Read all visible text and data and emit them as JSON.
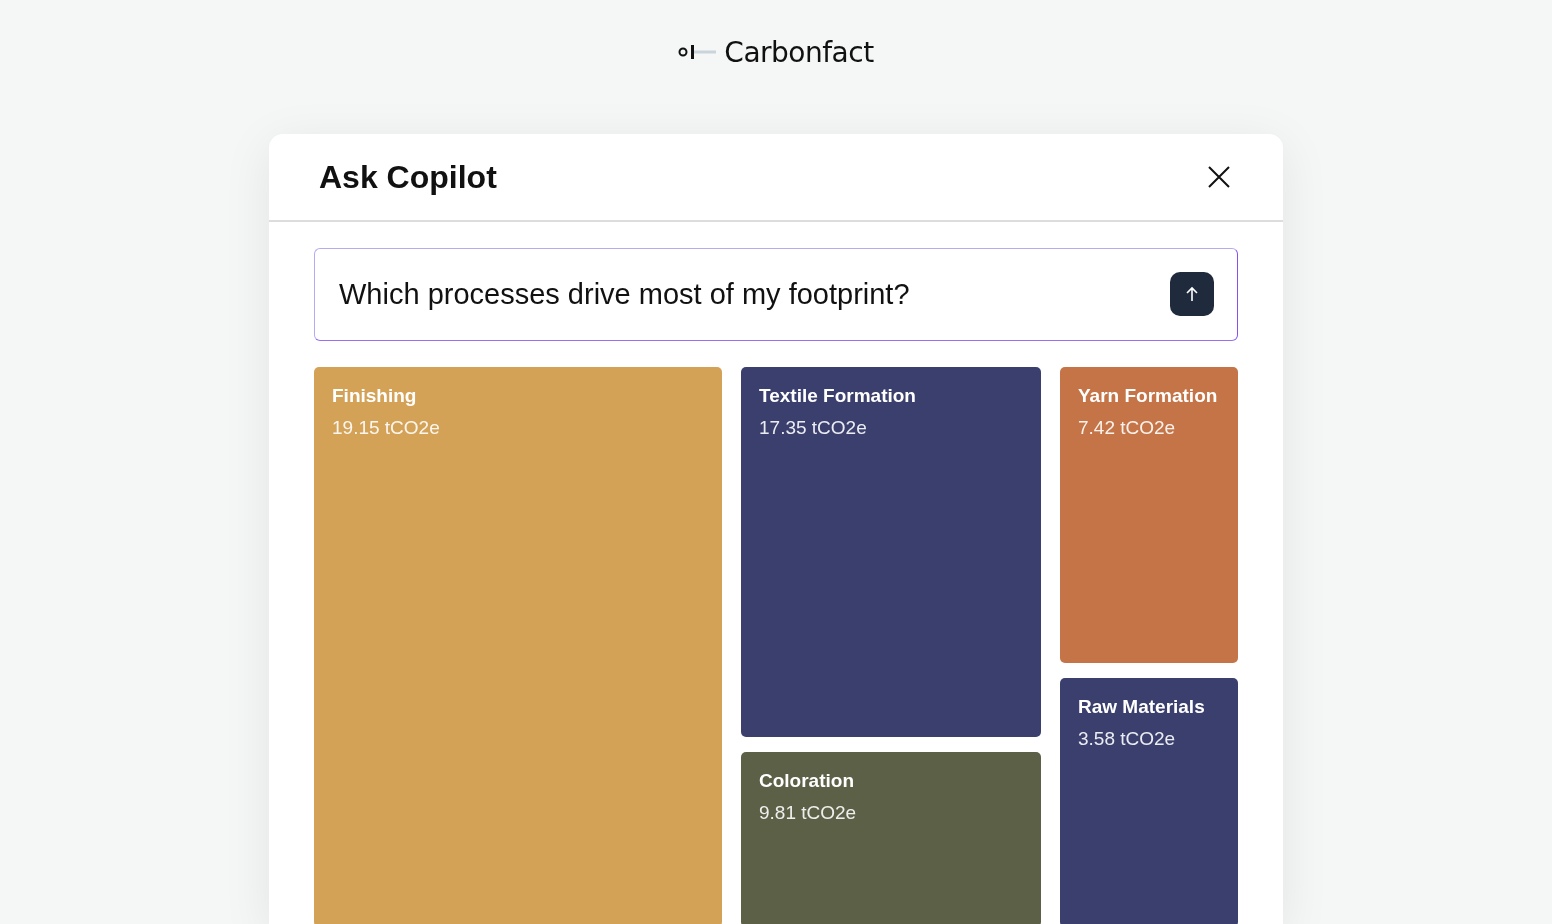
{
  "brand": "Carbonfact",
  "dialog": {
    "title": "Ask Copilot"
  },
  "query": {
    "value": "Which processes drive most of my footprint?"
  },
  "columns": [
    {
      "tiles": [
        {
          "name": "Finishing",
          "value": "19.15 tCO2e",
          "color": "#d4a257"
        }
      ]
    },
    {
      "tiles": [
        {
          "name": "Textile Formation",
          "value": "17.35 tCO2e",
          "color": "#3b3f6e"
        },
        {
          "name": "Coloration",
          "value": "9.81 tCO2e",
          "color": "#5b6046"
        }
      ]
    },
    {
      "tiles": [
        {
          "name": "Yarn Formation",
          "value": "7.42 tCO2e",
          "color": "#c47446"
        },
        {
          "name": "Raw Materials",
          "value": "3.58 tCO2e",
          "color": "#3b3f6e"
        }
      ]
    }
  ]
}
